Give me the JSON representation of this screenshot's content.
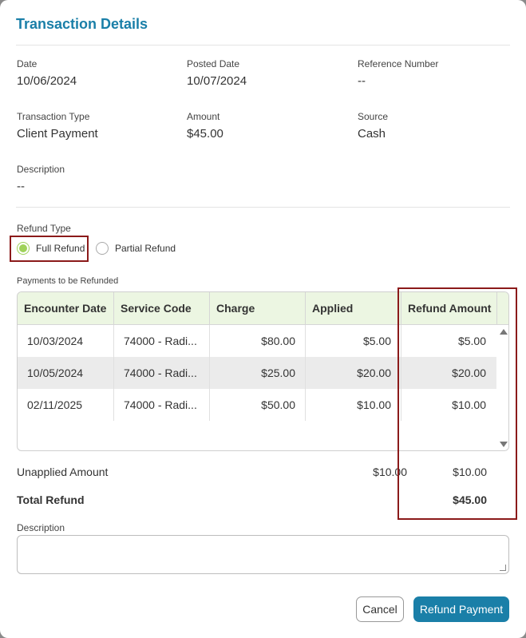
{
  "dialog": {
    "title": "Transaction Details"
  },
  "details": {
    "date_label": "Date",
    "date_value": "10/06/2024",
    "posted_label": "Posted Date",
    "posted_value": "10/07/2024",
    "reference_label": "Reference Number",
    "reference_value": "--",
    "type_label": "Transaction Type",
    "type_value": "Client Payment",
    "amount_label": "Amount",
    "amount_value": "$45.00",
    "source_label": "Source",
    "source_value": "Cash",
    "description_label": "Description",
    "description_value": "--"
  },
  "refund_type": {
    "label": "Refund Type",
    "options": [
      "Full Refund",
      "Partial Refund"
    ],
    "selected": "Full Refund"
  },
  "payments": {
    "label": "Payments to be Refunded",
    "columns": [
      "Encounter Date",
      "Service Code",
      "Charge",
      "Applied",
      "Refund Amount"
    ],
    "rows": [
      [
        "10/03/2024",
        "74000 - Radi...",
        "$80.00",
        "$5.00",
        "$5.00"
      ],
      [
        "10/05/2024",
        "74000 - Radi...",
        "$25.00",
        "$20.00",
        "$20.00"
      ],
      [
        "02/11/2025",
        "74000 - Radi...",
        "$50.00",
        "$10.00",
        "$10.00"
      ]
    ]
  },
  "summary": {
    "unapplied_label": "Unapplied Amount",
    "unapplied_applied": "$10.00",
    "unapplied_refund": "$10.00",
    "total_label": "Total Refund",
    "total_value": "$45.00"
  },
  "refund_description": {
    "label": "Description",
    "value": ""
  },
  "actions": {
    "cancel": "Cancel",
    "submit": "Refund Payment"
  },
  "colors": {
    "accent": "#1a7fa8",
    "radio_selected": "#9fd25a",
    "header_bg": "#ecf6e2",
    "annotation": "#8b1a1a"
  },
  "icons": {
    "scroll_up": "triangle-up-icon",
    "scroll_down": "triangle-down-icon",
    "resize": "resize-grip-icon"
  }
}
